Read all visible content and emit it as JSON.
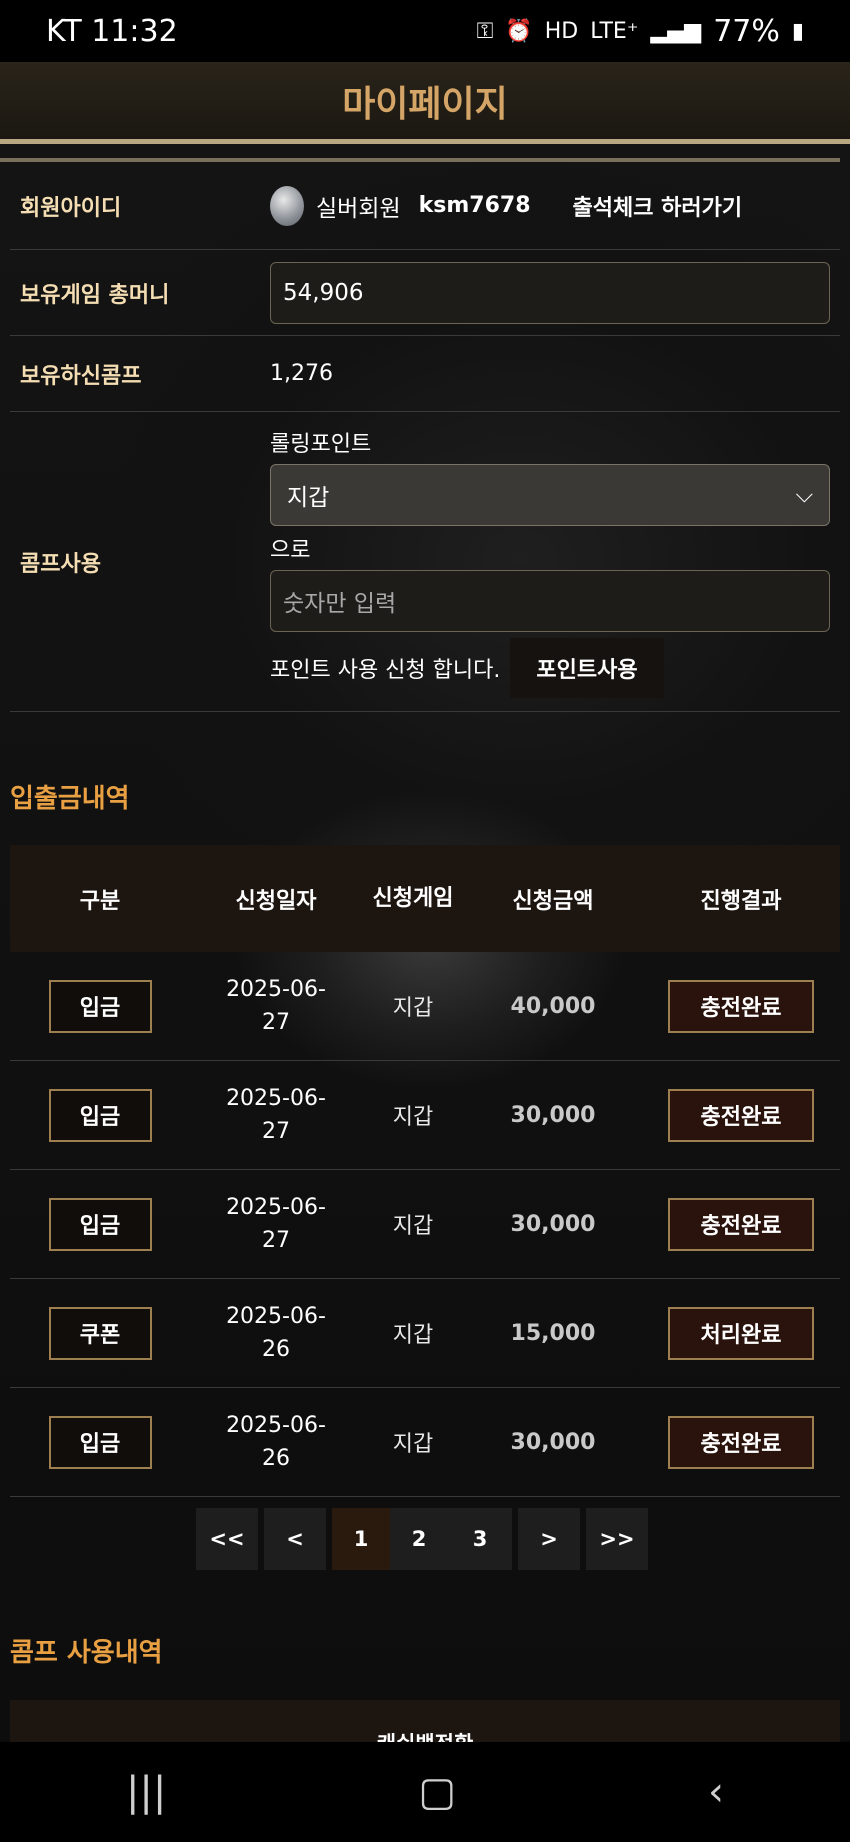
{
  "status_bar": {
    "carrier_time": "KT 11:32",
    "icons": [
      "key-icon",
      "alarm-icon",
      "hd-icon",
      "lte-icon",
      "signal-icon"
    ],
    "battery": "77%"
  },
  "header": {
    "title": "마이페이지"
  },
  "profile": {
    "member_id_label": "회원아이디",
    "grade": "실버회원",
    "user_id": "ksm7678",
    "attendance_link": "출석체크 하러가기",
    "money_label": "보유게임 총머니",
    "money_value": "54,906",
    "comp_label": "보유하신콤프",
    "comp_value": "1,276",
    "comp_use_label": "콤프사용",
    "rolling_label": "롤링포인트",
    "wallet_select": "지갑",
    "to_text": "으로",
    "amount_placeholder": "숫자만 입력",
    "apply_text": "포인트 사용 신청 합니다.",
    "use_button": "포인트사용"
  },
  "history": {
    "title": "입출금내역",
    "columns": [
      "구분",
      "신청일자",
      "신청게임",
      "신청금액",
      "진행결과"
    ],
    "rows": [
      {
        "type": "입금",
        "date": "2025-06-27",
        "game": "지갑",
        "amount": "40,000",
        "status": "충전완료"
      },
      {
        "type": "입금",
        "date": "2025-06-27",
        "game": "지갑",
        "amount": "30,000",
        "status": "충전완료"
      },
      {
        "type": "입금",
        "date": "2025-06-27",
        "game": "지갑",
        "amount": "30,000",
        "status": "충전완료"
      },
      {
        "type": "쿠폰",
        "date": "2025-06-26",
        "game": "지갑",
        "amount": "15,000",
        "status": "처리완료"
      },
      {
        "type": "입금",
        "date": "2025-06-26",
        "game": "지갑",
        "amount": "30,000",
        "status": "충전완료"
      }
    ]
  },
  "pagination": {
    "first": "<<",
    "prev": "<",
    "pages": [
      "1",
      "2",
      "3"
    ],
    "next": ">",
    "last": ">>",
    "current": "1"
  },
  "comp_history": {
    "title": "콤프 사용내역",
    "column": "캐쉬백전환"
  },
  "colors": {
    "accent": "#e8a043",
    "label": "#f5deb3",
    "status_bg": "#2b130d"
  }
}
